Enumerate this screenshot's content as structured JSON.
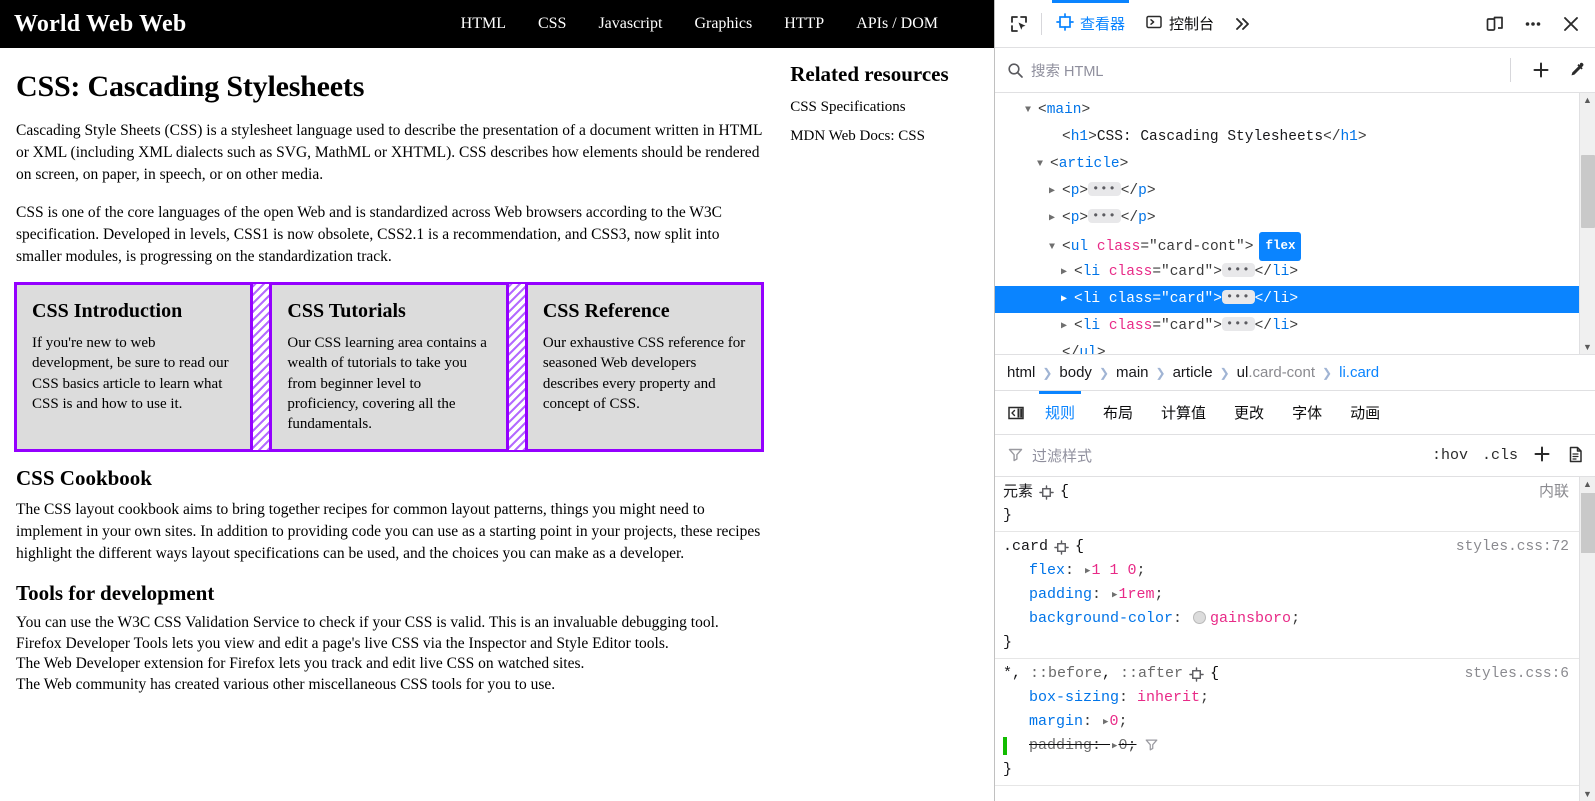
{
  "page": {
    "header": {
      "title": "World Web Web",
      "nav": [
        "HTML",
        "CSS",
        "Javascript",
        "Graphics",
        "HTTP",
        "APIs / DOM"
      ]
    },
    "title": "CSS: Cascading Stylesheets",
    "intro_paragraphs": [
      "Cascading Style Sheets (CSS) is a stylesheet language used to describe the presentation of a document written in HTML or XML (including XML dialects such as SVG, MathML or XHTML). CSS describes how elements should be rendered on screen, on paper, in speech, or on other media.",
      "CSS is one of the core languages of the open Web and is standardized across Web browsers according to the W3C specification. Developed in levels, CSS1 is now obsolete, CSS2.1 is a recommendation, and CSS3, now split into smaller modules, is progressing on the standardization track."
    ],
    "cards": [
      {
        "title": "CSS Introduction",
        "text": "If you're new to web development, be sure to read our CSS basics article to learn what CSS is and how to use it."
      },
      {
        "title": "CSS Tutorials",
        "text": "Our CSS learning area contains a wealth of tutorials to take you from beginner level to proficiency, covering all the fundamentals."
      },
      {
        "title": "CSS Reference",
        "text": "Our exhaustive CSS reference for seasoned Web developers describes every property and concept of CSS."
      }
    ],
    "cookbook": {
      "heading": "CSS Cookbook",
      "text": "The CSS layout cookbook aims to bring together recipes for common layout patterns, things you might need to implement in your own sites. In addition to providing code you can use as a starting point in your projects, these recipes highlight the different ways layout specifications can be used, and the choices you can make as a developer."
    },
    "tools": {
      "heading": "Tools for development",
      "lines": [
        "You can use the W3C CSS Validation Service to check if your CSS is valid. This is an invaluable debugging tool.",
        "Firefox Developer Tools lets you view and edit a page's live CSS via the Inspector and Style Editor tools.",
        "The Web Developer extension for Firefox lets you track and edit live CSS on watched sites.",
        "The Web community has created various other miscellaneous CSS tools for you to use."
      ]
    },
    "aside": {
      "heading": "Related resources",
      "items": [
        "CSS Specifications",
        "MDN Web Docs: CSS"
      ]
    }
  },
  "devtools": {
    "toolbar": {
      "picker_icon": "element-picker-icon",
      "tabs": [
        {
          "label": "查看器",
          "icon": "inspector-icon",
          "active": true
        },
        {
          "label": "控制台",
          "icon": "console-icon",
          "active": false
        }
      ],
      "more_tabs_label": "»",
      "responsive_icon": "responsive-design-mode-icon",
      "meatball_label": "•••",
      "close_label": "✕"
    },
    "search": {
      "placeholder": "搜索 HTML",
      "add_node_label": "+",
      "eyedropper_icon": "eyedropper-icon"
    },
    "dom": [
      {
        "indent": 1,
        "twisty": "open",
        "parts": [
          {
            "t": "punct",
            "v": "<"
          },
          {
            "t": "tag",
            "v": "main"
          },
          {
            "t": "punct",
            "v": ">"
          }
        ]
      },
      {
        "indent": 2,
        "twisty": "none",
        "parts": [
          {
            "t": "punct",
            "v": "<"
          },
          {
            "t": "tag",
            "v": "h1"
          },
          {
            "t": "punct",
            "v": ">"
          },
          {
            "t": "txt",
            "v": "CSS: Cascading Stylesheets"
          },
          {
            "t": "punct",
            "v": "</"
          },
          {
            "t": "tag",
            "v": "h1"
          },
          {
            "t": "punct",
            "v": ">"
          }
        ]
      },
      {
        "indent": 1.5,
        "twisty": "open",
        "parts": [
          {
            "t": "punct",
            "v": "<"
          },
          {
            "t": "tag",
            "v": "article"
          },
          {
            "t": "punct",
            "v": ">"
          }
        ]
      },
      {
        "indent": 2,
        "twisty": "closed",
        "parts": [
          {
            "t": "punct",
            "v": "<"
          },
          {
            "t": "tag",
            "v": "p"
          },
          {
            "t": "punct",
            "v": ">"
          },
          {
            "t": "ell",
            "v": "…"
          },
          {
            "t": "punct",
            "v": "</"
          },
          {
            "t": "tag",
            "v": "p"
          },
          {
            "t": "punct",
            "v": ">"
          }
        ]
      },
      {
        "indent": 2,
        "twisty": "closed",
        "parts": [
          {
            "t": "punct",
            "v": "<"
          },
          {
            "t": "tag",
            "v": "p"
          },
          {
            "t": "punct",
            "v": ">"
          },
          {
            "t": "ell",
            "v": "…"
          },
          {
            "t": "punct",
            "v": "</"
          },
          {
            "t": "tag",
            "v": "p"
          },
          {
            "t": "punct",
            "v": ">"
          }
        ]
      },
      {
        "indent": 2,
        "twisty": "open",
        "parts": [
          {
            "t": "punct",
            "v": "<"
          },
          {
            "t": "tag",
            "v": "ul"
          },
          {
            "t": "sp",
            "v": " "
          },
          {
            "t": "attr-name",
            "v": "class"
          },
          {
            "t": "punct",
            "v": "="
          },
          {
            "t": "attr-val",
            "v": "\"card-cont\""
          },
          {
            "t": "punct",
            "v": ">"
          },
          {
            "t": "flex",
            "v": "flex"
          }
        ]
      },
      {
        "indent": 2.5,
        "twisty": "closed",
        "parts": [
          {
            "t": "punct",
            "v": "<"
          },
          {
            "t": "tag",
            "v": "li"
          },
          {
            "t": "sp",
            "v": " "
          },
          {
            "t": "attr-name",
            "v": "class"
          },
          {
            "t": "punct",
            "v": "="
          },
          {
            "t": "attr-val",
            "v": "\"card\""
          },
          {
            "t": "punct",
            "v": ">"
          },
          {
            "t": "ell",
            "v": "…"
          },
          {
            "t": "punct",
            "v": "</"
          },
          {
            "t": "tag",
            "v": "li"
          },
          {
            "t": "punct",
            "v": ">"
          }
        ]
      },
      {
        "indent": 2.5,
        "twisty": "closed",
        "selected": true,
        "parts": [
          {
            "t": "punct",
            "v": "<"
          },
          {
            "t": "tag",
            "v": "li"
          },
          {
            "t": "sp",
            "v": " "
          },
          {
            "t": "attr-name",
            "v": "class"
          },
          {
            "t": "punct",
            "v": "="
          },
          {
            "t": "attr-val",
            "v": "\"card\""
          },
          {
            "t": "punct",
            "v": ">"
          },
          {
            "t": "ell",
            "v": "…"
          },
          {
            "t": "punct",
            "v": "</"
          },
          {
            "t": "tag",
            "v": "li"
          },
          {
            "t": "punct",
            "v": ">"
          }
        ]
      },
      {
        "indent": 2.5,
        "twisty": "closed",
        "parts": [
          {
            "t": "punct",
            "v": "<"
          },
          {
            "t": "tag",
            "v": "li"
          },
          {
            "t": "sp",
            "v": " "
          },
          {
            "t": "attr-name",
            "v": "class"
          },
          {
            "t": "punct",
            "v": "="
          },
          {
            "t": "attr-val",
            "v": "\"card\""
          },
          {
            "t": "punct",
            "v": ">"
          },
          {
            "t": "ell",
            "v": "…"
          },
          {
            "t": "punct",
            "v": "</"
          },
          {
            "t": "tag",
            "v": "li"
          },
          {
            "t": "punct",
            "v": ">"
          }
        ]
      },
      {
        "indent": 2,
        "twisty": "none",
        "parts": [
          {
            "t": "punct",
            "v": "</"
          },
          {
            "t": "tag",
            "v": "ul"
          },
          {
            "t": "punct",
            "v": ">"
          }
        ]
      }
    ],
    "breadcrumb": [
      {
        "tag": "html",
        "cls": "",
        "selected": false
      },
      {
        "tag": "body",
        "cls": "",
        "selected": false
      },
      {
        "tag": "main",
        "cls": "",
        "selected": false
      },
      {
        "tag": "article",
        "cls": "",
        "selected": false
      },
      {
        "tag": "ul",
        "cls": ".card-cont",
        "selected": false
      },
      {
        "tag": "li",
        "cls": ".card",
        "selected": true
      }
    ],
    "rules_tabs": [
      {
        "label": "规则",
        "active": true
      },
      {
        "label": "布局",
        "active": false
      },
      {
        "label": "计算值",
        "active": false
      },
      {
        "label": "更改",
        "active": false
      },
      {
        "label": "字体",
        "active": false
      },
      {
        "label": "动画",
        "active": false
      }
    ],
    "filter": {
      "placeholder": "过滤样式",
      "hov_label": ":hov",
      "cls_label": ".cls",
      "add_rule_label": "+",
      "stylesheet_icon": "new-stylesheet-icon"
    },
    "rules": [
      {
        "selector": "元素",
        "selector_is_text": true,
        "source": "内联",
        "source_inline": true,
        "declarations": []
      },
      {
        "selector": ".card",
        "source": "styles.css:72",
        "declarations": [
          {
            "prop": "flex",
            "value": "1 1 0",
            "expander": true
          },
          {
            "prop": "padding",
            "value": "1rem",
            "expander": true
          },
          {
            "prop": "background-color",
            "value": "gainsboro",
            "swatch": "gainsboro"
          }
        ]
      },
      {
        "selector": "*, ::before, ::after",
        "source": "styles.css:6",
        "declarations": [
          {
            "prop": "box-sizing",
            "value": "inherit"
          },
          {
            "prop": "margin",
            "value": "0",
            "expander": true
          },
          {
            "prop": "padding",
            "value": "0",
            "expander": true,
            "overridden": true,
            "filter_icon": true,
            "green_bar": true
          }
        ]
      }
    ]
  }
}
